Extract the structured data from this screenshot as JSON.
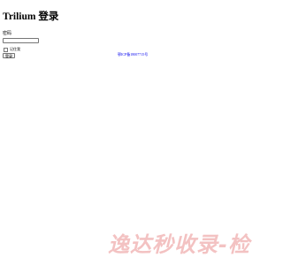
{
  "page": {
    "title": "Trilium 登录"
  },
  "login_form": {
    "password_label": "密码",
    "password_value": "",
    "remember_checked": false,
    "remember_label": "记住我",
    "login_button_label": "登录"
  },
  "footer": {
    "beian_link_text": "鄂ICP备18007715号"
  },
  "watermark": {
    "text": "逸达秒收录-检"
  }
}
